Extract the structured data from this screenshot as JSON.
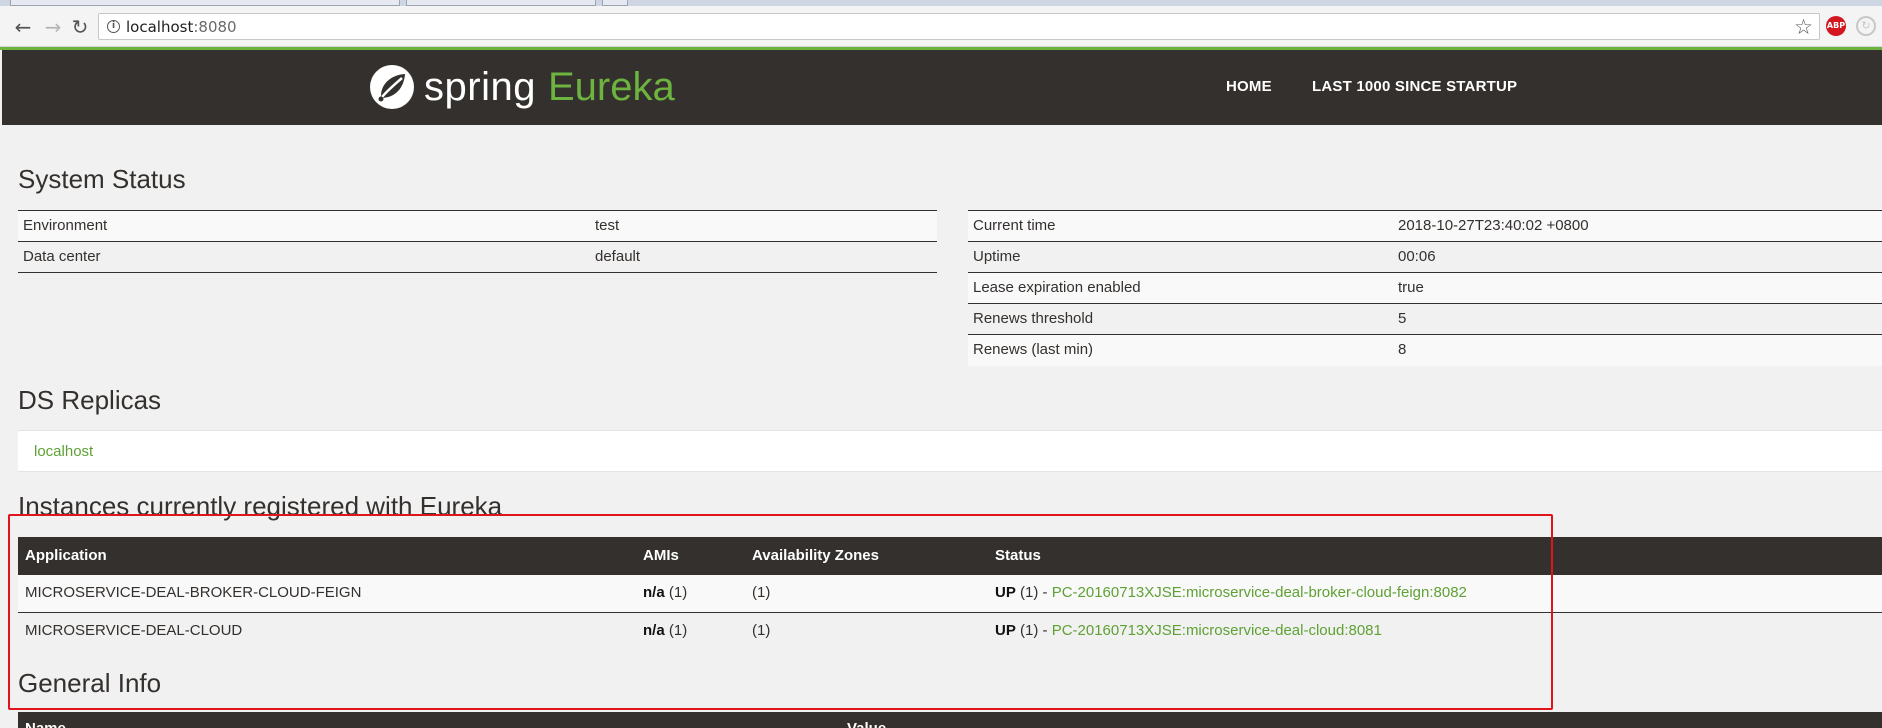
{
  "browser": {
    "url_host": "localhost",
    "url_port": ":8080",
    "back_icon": "arrow-left-icon",
    "forward_icon": "arrow-right-icon",
    "reload_icon": "reload-icon",
    "bookmark_icon": "star-icon",
    "abp_label": "ABP",
    "accent_color": "#6db33f"
  },
  "navbar": {
    "brand_spring": "spring",
    "brand_eureka": "Eureka",
    "home": "HOME",
    "last1000": "LAST 1000 SINCE STARTUP"
  },
  "system_status": {
    "title": "System Status",
    "left": [
      {
        "key": "Environment",
        "value": "test"
      },
      {
        "key": "Data center",
        "value": "default"
      }
    ],
    "right": [
      {
        "key": "Current time",
        "value": "2018-10-27T23:40:02 +0800"
      },
      {
        "key": "Uptime",
        "value": "00:06"
      },
      {
        "key": "Lease expiration enabled",
        "value": "true"
      },
      {
        "key": "Renews threshold",
        "value": "5"
      },
      {
        "key": "Renews (last min)",
        "value": "8"
      }
    ]
  },
  "ds_replicas": {
    "title": "DS Replicas",
    "items": [
      "localhost"
    ]
  },
  "instances": {
    "title": "Instances currently registered with Eureka",
    "headers": [
      "Application",
      "AMIs",
      "Availability Zones",
      "Status"
    ],
    "rows": [
      {
        "application": "MICROSERVICE-DEAL-BROKER-CLOUD-FEIGN",
        "ami_strong": "n/a",
        "ami_count": " (1)",
        "zones": "(1)",
        "status_strong": "UP",
        "status_count": " (1) - ",
        "instance_link": "PC-20160713XJSE:microservice-deal-broker-cloud-feign:8082"
      },
      {
        "application": "MICROSERVICE-DEAL-CLOUD",
        "ami_strong": "n/a",
        "ami_count": " (1)",
        "zones": "(1)",
        "status_strong": "UP",
        "status_count": " (1) - ",
        "instance_link": "PC-20160713XJSE:microservice-deal-cloud:8081"
      }
    ]
  },
  "general_info": {
    "title": "General Info",
    "headers": [
      "Name",
      "Value"
    ]
  }
}
